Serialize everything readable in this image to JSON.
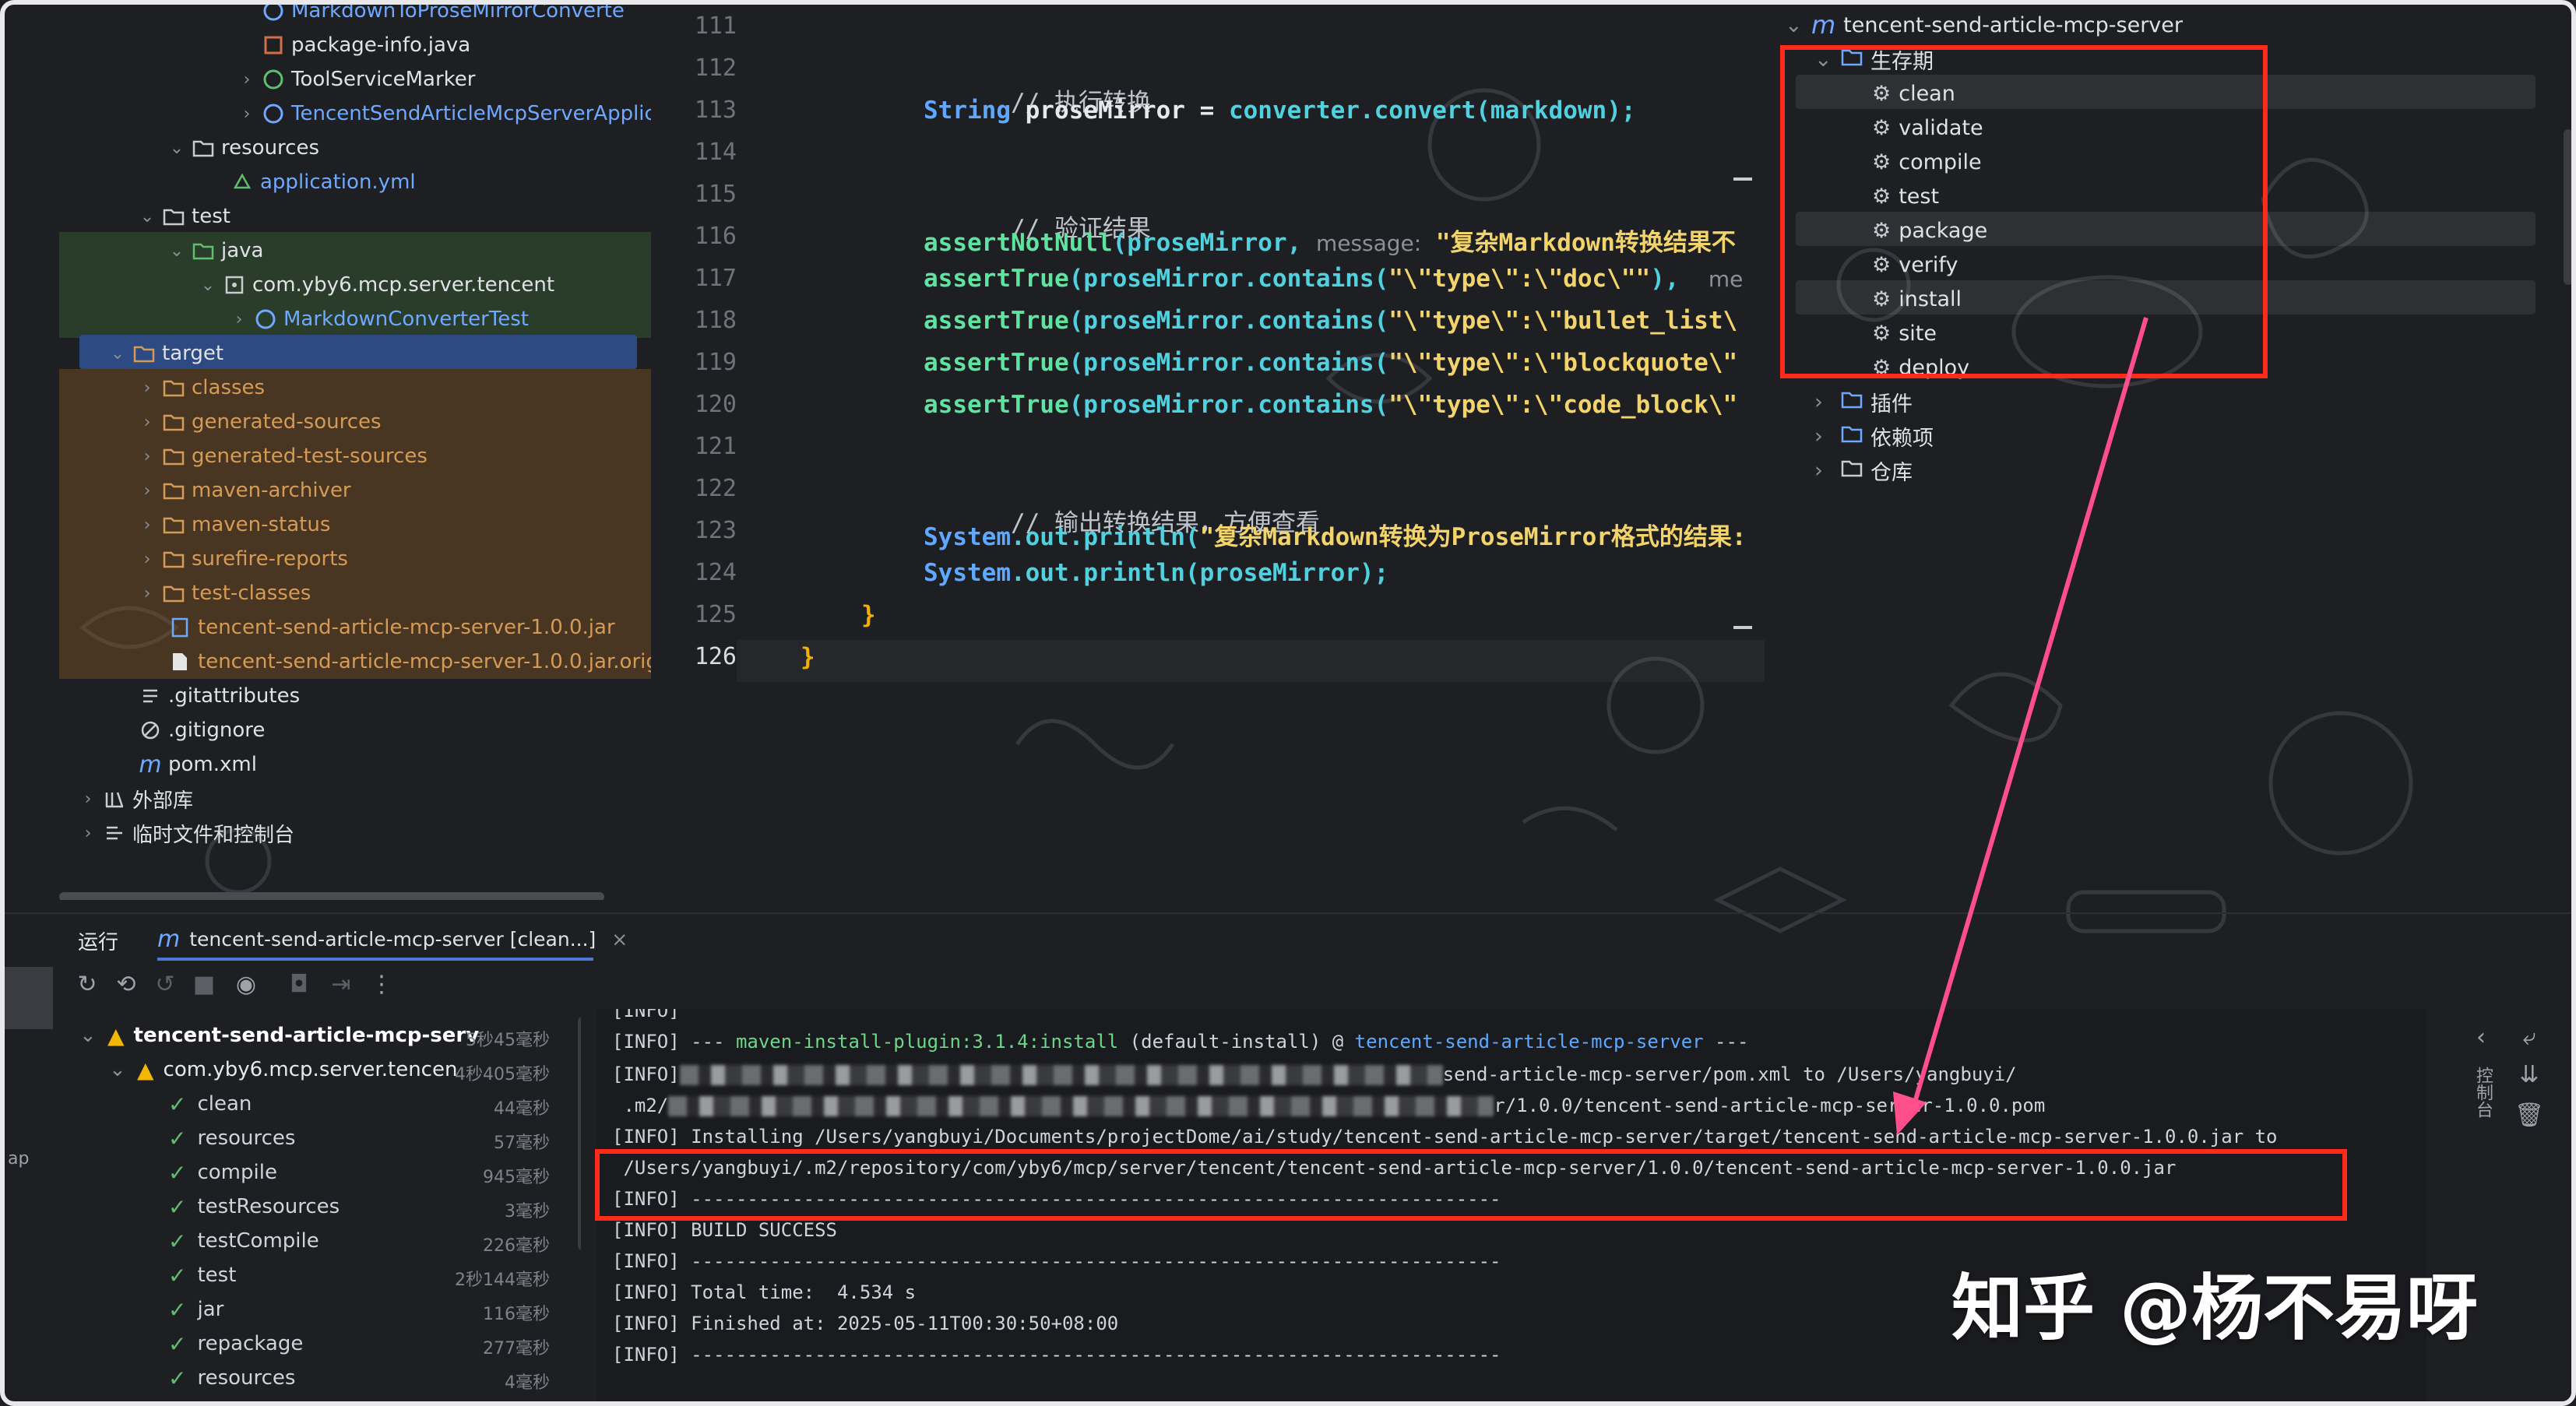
{
  "project_tree": {
    "items": [
      {
        "label": "MarkdownToProseMirrorConverte",
        "kind": "class"
      },
      {
        "label": "package-info.java",
        "kind": "file"
      },
      {
        "label": "ToolServiceMarker",
        "kind": "interface"
      },
      {
        "label": "TencentSendArticleMcpServerApplicati",
        "kind": "app"
      },
      {
        "label": "resources",
        "kind": "folder"
      },
      {
        "label": "application.yml",
        "kind": "yml"
      },
      {
        "label": "test",
        "kind": "folder"
      },
      {
        "label": "java",
        "kind": "folder"
      },
      {
        "label": "com.yby6.mcp.server.tencent",
        "kind": "package"
      },
      {
        "label": "MarkdownConverterTest",
        "kind": "class"
      },
      {
        "label": "target",
        "kind": "folder"
      },
      {
        "label": "classes",
        "kind": "folder"
      },
      {
        "label": "generated-sources",
        "kind": "folder"
      },
      {
        "label": "generated-test-sources",
        "kind": "folder"
      },
      {
        "label": "maven-archiver",
        "kind": "folder"
      },
      {
        "label": "maven-status",
        "kind": "folder"
      },
      {
        "label": "surefire-reports",
        "kind": "folder"
      },
      {
        "label": "test-classes",
        "kind": "folder"
      },
      {
        "label": "tencent-send-article-mcp-server-1.0.0.jar",
        "kind": "jar"
      },
      {
        "label": "tencent-send-article-mcp-server-1.0.0.jar.origin",
        "kind": "file"
      },
      {
        "label": ".gitattributes",
        "kind": "file"
      },
      {
        "label": ".gitignore",
        "kind": "file"
      },
      {
        "label": "pom.xml",
        "kind": "maven"
      },
      {
        "label": "外部库",
        "kind": "library"
      },
      {
        "label": "临时文件和控制台",
        "kind": "scratch"
      }
    ]
  },
  "editor": {
    "line_numbers": [
      "111",
      "112",
      "113",
      "114",
      "115",
      "116",
      "117",
      "118",
      "119",
      "120",
      "121",
      "122",
      "123",
      "124",
      "125",
      "126"
    ],
    "current_line": "126",
    "lines": {
      "l112_comment": "// 执行转换",
      "l113_type": "String",
      "l113_var": " proseMirror = ",
      "l113_obj": "converter",
      "l113_call": ".convert(markdown);",
      "l115_comment": "// 验证结果",
      "l116_fn": "assertNotNull",
      "l116_arg": "(proseMirror, ",
      "l116_hint": "message:",
      "l116_str": " \"复杂Markdown转换结果不",
      "l117_fn": "assertTrue",
      "l117_mid": "(proseMirror.contains(",
      "l117_str": "\"\\\"type\\\":\\\"doc\\\"\"",
      "l117_tail": "),  ",
      "l117_hint": "me",
      "l118_str": "\"\\\"type\\\":\\\"bullet_list\\",
      "l119_str": "\"\\\"type\\\":\\\"blockquote\\\"",
      "l120_str": "\"\\\"type\\\":\\\"code_block\\\"",
      "l122_comment": "// 输出转换结果，方便查看",
      "l123_sys": "System",
      "l123_out": ".out.",
      "l123_call": "println(",
      "l123_str": "\"复杂Markdown转换为ProseMirror格式的结果:",
      "l124_tail": "println(proseMirror);",
      "l125_brace": "}",
      "l126_brace": "}"
    }
  },
  "maven": {
    "project": "tencent-send-article-mcp-server",
    "lifecycle_label": "生存期",
    "phases": [
      "clean",
      "validate",
      "compile",
      "test",
      "package",
      "verify",
      "install",
      "site",
      "deploy"
    ],
    "groups": [
      "插件",
      "依赖项",
      "仓库"
    ]
  },
  "run": {
    "tab_label": "运行",
    "config_tab": "tencent-send-article-mcp-server [clean...]",
    "tree": [
      {
        "label": "tencent-send-article-mcp-serv",
        "time": "5秒45毫秒",
        "status": "warn"
      },
      {
        "label": "com.yby6.mcp.server.tencen",
        "time": "4秒405毫秒",
        "status": "warn"
      },
      {
        "label": "clean",
        "time": "44毫秒",
        "status": "ok"
      },
      {
        "label": "resources",
        "time": "57毫秒",
        "status": "ok"
      },
      {
        "label": "compile",
        "time": "945毫秒",
        "status": "ok"
      },
      {
        "label": "testResources",
        "time": "3毫秒",
        "status": "ok"
      },
      {
        "label": "testCompile",
        "time": "226毫秒",
        "status": "ok"
      },
      {
        "label": "test",
        "time": "2秒144毫秒",
        "status": "ok"
      },
      {
        "label": "jar",
        "time": "116毫秒",
        "status": "ok"
      },
      {
        "label": "repackage",
        "time": "277毫秒",
        "status": "ok"
      },
      {
        "label": "resources",
        "time": "4毫秒",
        "status": "ok"
      }
    ]
  },
  "console": {
    "l0": "[INFO]",
    "l1_pre": "[INFO] --- ",
    "l1_plugin": "maven-install-plugin:3.1.4:install",
    "l1_mid": " (default-install) @ ",
    "l1_proj": "tencent-send-article-mcp-server",
    "l1_tail": " ---",
    "l2_pre": "[INFO]",
    "l2_tail": "send-article-mcp-server/pom.xml to /Users/yangbuyi/",
    "l3_pre": " .m2/",
    "l3_tail": "r/1.0.0/tencent-send-article-mcp-server-1.0.0.pom",
    "l4": "[INFO] Installing /Users/yangbuyi/Documents/projectDome/ai/study/tencent-send-article-mcp-server/target/tencent-send-article-mcp-server-1.0.0.jar to",
    "l5": " /Users/yangbuyi/.m2/repository/com/yby6/mcp/server/tencent/tencent-send-article-mcp-server/1.0.0/tencent-send-article-mcp-server-1.0.0.jar",
    "l6": "[INFO] ------------------------------------------------------------------------",
    "l7": "[INFO] BUILD SUCCESS",
    "l8": "[INFO] ------------------------------------------------------------------------",
    "l9": "[INFO] Total time:  4.534 s",
    "l10": "[INFO] Finished at: 2025-05-11T00:30:50+08:00",
    "l11": "[INFO] ------------------------------------------------------------------------"
  },
  "side_labels": {
    "left_edge": "ap",
    "right_vertical": "控制台"
  },
  "watermark": "知乎 @杨不易呀",
  "colors": {
    "annotation_red": "#ff2a1a",
    "arrow_pink": "#ff4f8b"
  }
}
